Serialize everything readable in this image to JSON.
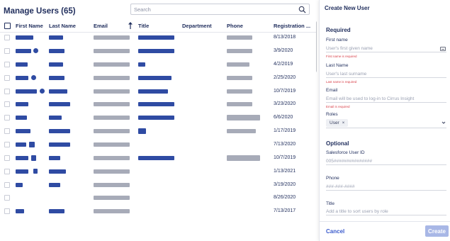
{
  "page": {
    "title": "Manage Users (65)",
    "search_placeholder": "Search"
  },
  "table": {
    "columns": [
      "First Name",
      "Last Name",
      "Email",
      "Title",
      "Department",
      "Phone",
      "Registration ..."
    ],
    "rows": [
      {
        "date": "8/13/2018"
      },
      {
        "date": "3/9/2020"
      },
      {
        "date": "4/2/2019"
      },
      {
        "date": "2/25/2020"
      },
      {
        "date": "10/7/2019"
      },
      {
        "date": "3/23/2020"
      },
      {
        "date": "6/6/2020"
      },
      {
        "date": "1/17/2019"
      },
      {
        "date": "7/13/2020"
      },
      {
        "date": "10/7/2019"
      },
      {
        "date": "1/13/2021"
      },
      {
        "date": "3/19/2020"
      },
      {
        "date": "8/26/2020"
      },
      {
        "date": "7/13/2017"
      }
    ]
  },
  "panel": {
    "title": "Create New User",
    "required_heading": "Required",
    "first_name_label": "First name",
    "first_name_placeholder": "User's first given name",
    "first_name_error": "First name is required",
    "last_name_label": "Last Name",
    "last_name_placeholder": "User's last surname",
    "last_name_error": "Last name is required",
    "email_label": "Email",
    "email_placeholder": "Email will be used to log-in to Cirrus Insight",
    "email_error": "Email is required",
    "roles_label": "Roles",
    "roles_chip": "User",
    "roles_chip_remove": "×",
    "optional_heading": "Optional",
    "sfid_label": "Salesforce User ID",
    "sfid_placeholder": "005###############",
    "phone_label": "Phone",
    "phone_placeholder": "###-###-####",
    "title_label": "Title",
    "title_placeholder": "Add a title to sort users by role",
    "cancel_label": "Cancel",
    "create_label": "Create"
  },
  "colors": {
    "accent": "#2f4ba3",
    "redacted_gray": "#a7abb8",
    "error": "#d8414a",
    "create_button": "#a8b7e6",
    "cancel_link": "#3b5bcc"
  },
  "icons": [
    "search-icon",
    "sort-up-icon",
    "sync-badge-icon",
    "id-card-icon",
    "chevron-down-icon"
  ]
}
